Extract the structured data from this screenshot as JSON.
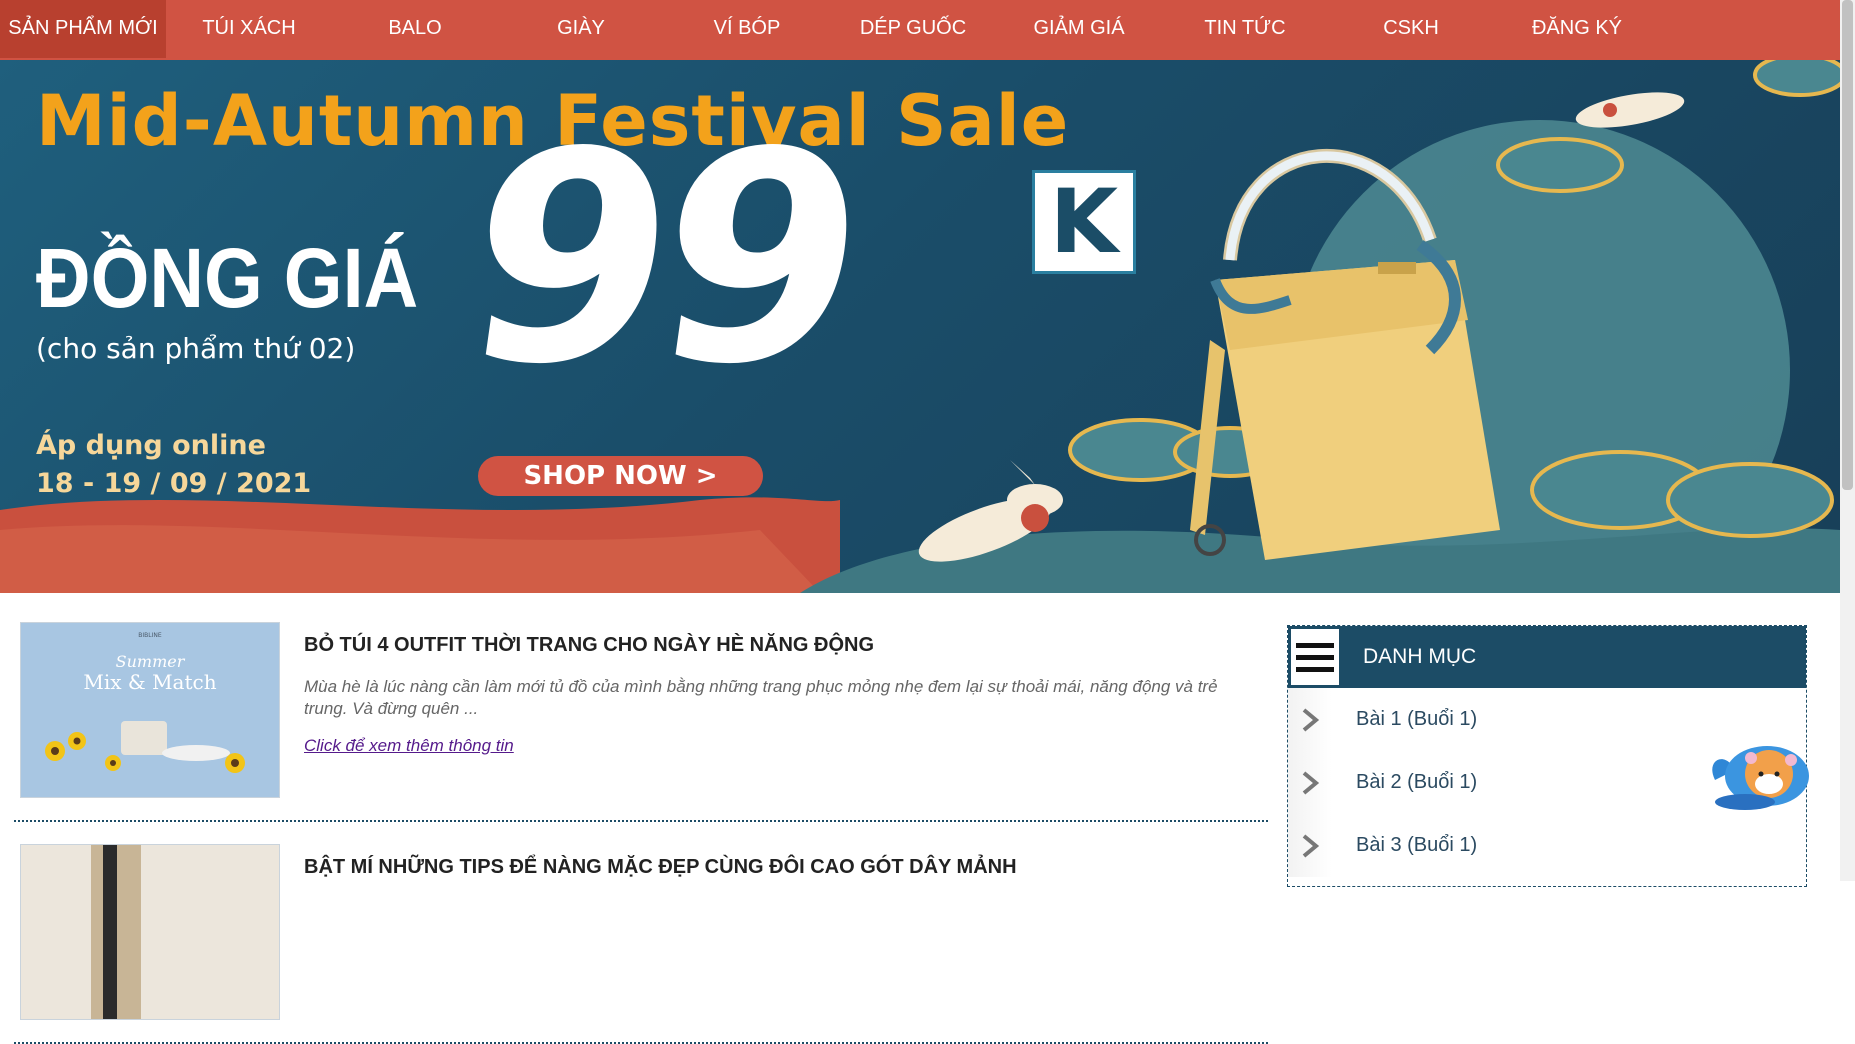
{
  "nav": {
    "items": [
      {
        "label": "SẢN PHẨM MỚI"
      },
      {
        "label": "TÚI XÁCH"
      },
      {
        "label": "BALO"
      },
      {
        "label": "GIÀY"
      },
      {
        "label": "VÍ BÓP"
      },
      {
        "label": "DÉP GUỐC"
      },
      {
        "label": "GIẢM GIÁ"
      },
      {
        "label": "TIN TỨC"
      },
      {
        "label": "CSKH"
      },
      {
        "label": "ĐĂNG KÝ"
      }
    ]
  },
  "banner": {
    "title": "Mid-Autumn Festival Sale",
    "headline": "ĐỒNG GIÁ",
    "subheadline": "(cho sản phẩm thứ 02)",
    "price_number": "99",
    "price_unit": "K",
    "apply_text": "Áp dụng online",
    "date_text": "18 - 19 / 09 / 2021",
    "cta_label": "SHOP NOW >",
    "colors": {
      "bg": "#1a4d69",
      "title": "#f3a21b",
      "cta": "#d05343"
    }
  },
  "posts": [
    {
      "title": "BỎ TÚI 4 OUTFIT THỜI TRANG CHO NGÀY HÈ NĂNG ĐỘNG",
      "excerpt": "Mùa hè là lúc nàng cần làm mới tủ đồ của mình bằng những trang phục mỏng nhẹ đem lại sự thoải mái, năng động và trẻ trung. Và đừng quên ...",
      "link_label": "Click để xem thêm thông tin",
      "thumb": {
        "brand": "BIBLINE",
        "line1": "Summer",
        "line2": "Mix & Match"
      }
    },
    {
      "title": "BẬT MÍ NHỮNG TIPS ĐỂ NÀNG MẶC ĐẸP CÙNG ĐÔI CAO GÓT DÂY MẢNH"
    }
  ],
  "sidebar": {
    "title": "DANH MỤC",
    "items": [
      {
        "label": "Bài 1 (Buổi 1)"
      },
      {
        "label": "Bài 2 (Buổi 1)"
      },
      {
        "label": "Bài 3 (Buổi 1)"
      }
    ]
  }
}
